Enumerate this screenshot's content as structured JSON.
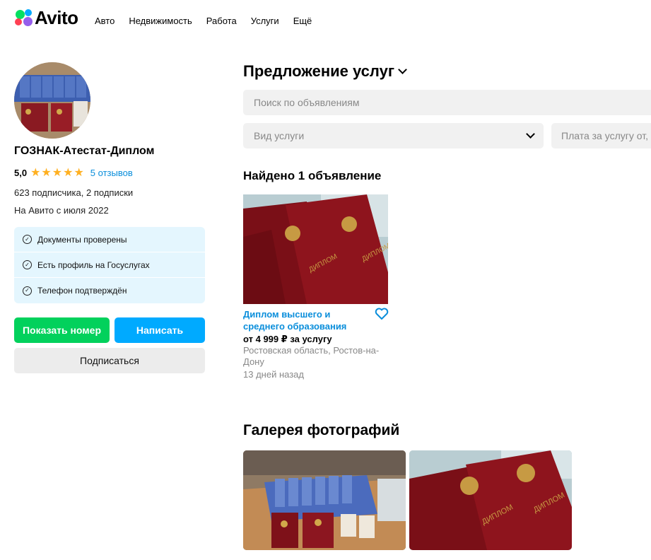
{
  "header": {
    "logo_text": "Avito",
    "nav": [
      "Авто",
      "Недвижимость",
      "Работа",
      "Услуги",
      "Ещё"
    ]
  },
  "seller": {
    "name": "ГОЗНАК-Атестат-Диплом",
    "rating": "5,0",
    "stars": "★★★★★",
    "reviews": "5 отзывов",
    "subscribers": "623 подписчика, 2 подписки",
    "since": "На Авито с июля 2022",
    "verifications": [
      "Документы проверены",
      "Есть профиль на Госуслугах",
      "Телефон подтверждён"
    ],
    "show_phone": "Показать номер",
    "write": "Написать",
    "subscribe": "Подписаться"
  },
  "main": {
    "title": "Предложение услуг",
    "search_placeholder": "Поиск по объявлениям",
    "service_type": "Вид услуги",
    "price_placeholder": "Плата за услугу от, ₽",
    "found": "Найдено 1 объявление"
  },
  "listing": {
    "title": "Диплом высшего и среднего образования",
    "price": "от 4 999 ₽ за услугу",
    "location": "Ростовская область, Ростов-на-Дону",
    "date": "13 дней назад",
    "image_icon": "diploma-photo"
  },
  "gallery": {
    "title": "Галерея фотографий"
  },
  "colors": {
    "green": "#02d15c",
    "blue": "#00aaff",
    "link": "#0a8edb",
    "star": "#ffb021",
    "verify_bg": "#e4f6fe"
  }
}
